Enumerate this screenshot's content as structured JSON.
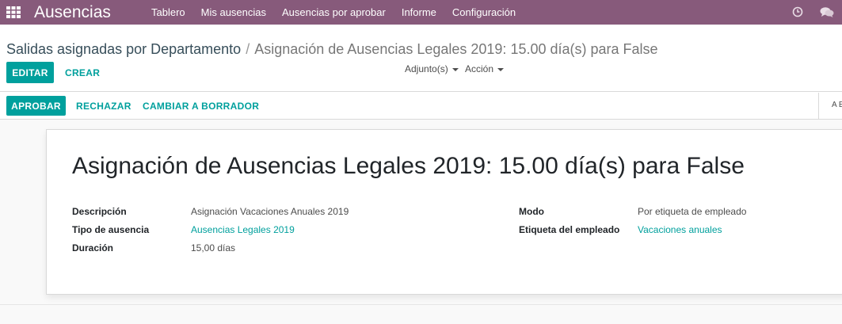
{
  "navbar": {
    "app_name": "Ausencias",
    "menu": [
      "Tablero",
      "Mis ausencias",
      "Ausencias por aprobar",
      "Informe",
      "Configuración"
    ],
    "brand_color": "#875a7b",
    "icons": [
      "apps-grid-icon",
      "clock-icon",
      "chat-icon"
    ]
  },
  "breadcrumb": {
    "parent": "Salidas asignadas por Departamento",
    "separator": "/",
    "current": "Asignación de Ausencias Legales 2019: 15.00 día(s) para False"
  },
  "toolbar": {
    "edit_label": "EDITAR",
    "create_label": "CREAR",
    "attachments_label": "Adjunto(s)",
    "action_label": "Acción"
  },
  "statusbar": {
    "approve_label": "APROBAR",
    "refuse_label": "RECHAZAR",
    "draft_label": "CAMBIAR A BORRADOR",
    "edge_text": "A E"
  },
  "form": {
    "title": "Asignación de Ausencias Legales 2019: 15.00 día(s) para False",
    "left_fields": [
      {
        "label": "Descripción",
        "value": "Asignación Vacaciones Anuales 2019"
      },
      {
        "label": "Tipo de ausencia",
        "value": "Ausencias Legales 2019"
      },
      {
        "label": "Duración",
        "value": "15,00 días"
      }
    ],
    "right_fields": [
      {
        "label": "Modo",
        "value": "Por etiqueta de empleado"
      },
      {
        "label": "Etiqueta del empleado",
        "value": "Vacaciones anuales"
      }
    ],
    "accent_color": "#00a09d"
  }
}
